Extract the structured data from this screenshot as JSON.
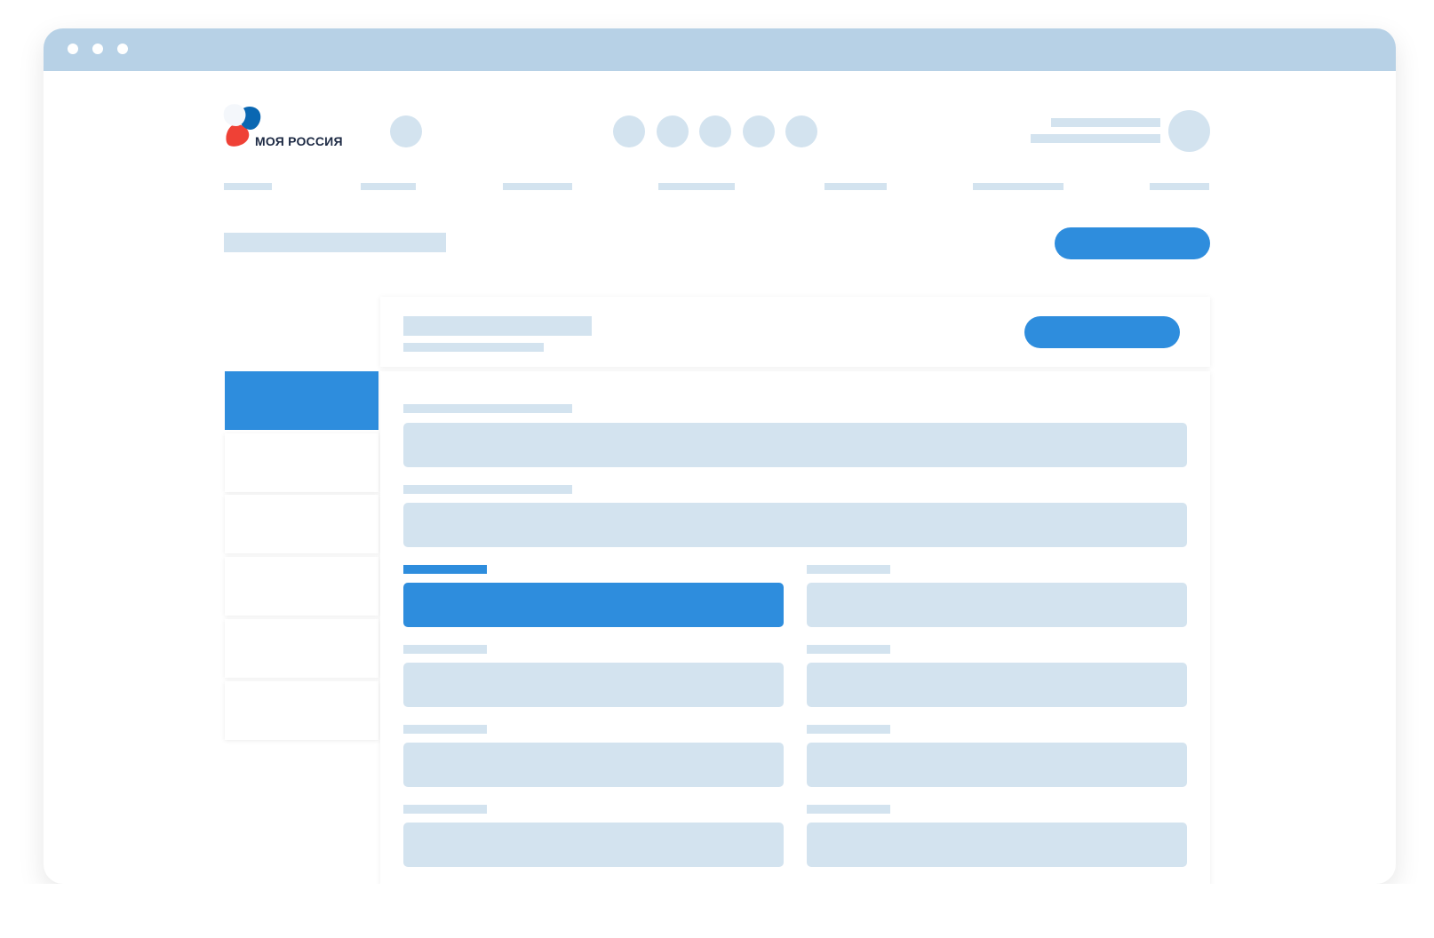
{
  "colors": {
    "titlebar": "#b7d1e6",
    "placeholder": "#d3e3ef",
    "accent": "#2e8ddd",
    "logo_red": "#ef4136",
    "logo_blue": "#0a67b2",
    "logo_text": "#1d2a44"
  },
  "logo": {
    "text": "МОЯ РОССИЯ",
    "icon": "tricolor-flag-icon"
  }
}
